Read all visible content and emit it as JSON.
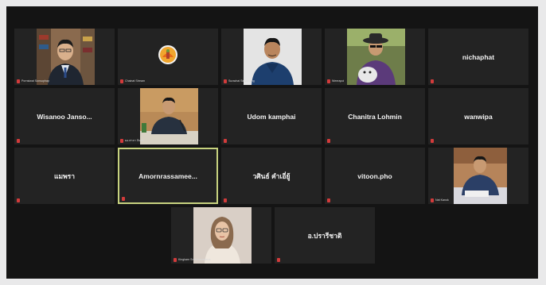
{
  "participants": [
    {
      "display": "",
      "label": "Pornsiwat Sonsuphap",
      "video": "man-suit-bookshelf"
    },
    {
      "display": "",
      "label": "Chainat Stream",
      "video": "emblem-logo"
    },
    {
      "display": "",
      "label": "Surachai Siriyawong",
      "video": "man-blue-shirt"
    },
    {
      "display": "",
      "label": "Weerapol",
      "video": "man-hat-dog"
    },
    {
      "display": "nichaphat",
      "label": ""
    },
    {
      "display": "Wisanoo  Janso...",
      "label": ""
    },
    {
      "display": "",
      "label": "ผอ.ศาลา จันทร",
      "video": "man-desk-microphone"
    },
    {
      "display": "Udom kamphai",
      "label": ""
    },
    {
      "display": "Chanitra Lohmin",
      "label": ""
    },
    {
      "display": "wanwipa",
      "label": ""
    },
    {
      "display": "แมพรา",
      "label": ""
    },
    {
      "display": "Amornrassamee...",
      "label": "",
      "active": true
    },
    {
      "display": "วศินธ์  คำเอี่ยู้",
      "label": ""
    },
    {
      "display": "vitoon.pho",
      "label": ""
    },
    {
      "display": "",
      "label": "Nat Kanok",
      "video": "man-conference-room"
    },
    {
      "display": "",
      "label": "Kingkarn Srivichaivattana",
      "video": "woman-glasses"
    },
    {
      "display": "อ.ปรารีชาติ",
      "label": ""
    }
  ],
  "colors": {
    "stage": "#141414",
    "tile": "#232323",
    "active_border": "#c7d27f",
    "mic_muted": "#d23b3b"
  }
}
